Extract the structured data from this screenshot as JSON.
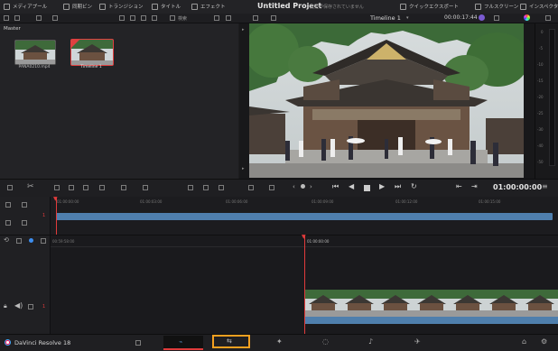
{
  "header": {
    "app_title": "Untitled Project",
    "status_text": "変更が保存されていません",
    "tabs_left": [
      {
        "label": "メディアプール",
        "icon": "media-pool-icon"
      },
      {
        "label": "同期ビン",
        "icon": "sync-bin-icon"
      },
      {
        "label": "トランジション",
        "icon": "transitions-icon"
      },
      {
        "label": "タイトル",
        "icon": "titles-icon"
      },
      {
        "label": "エフェクト",
        "icon": "effects-icon"
      }
    ],
    "tabs_right": [
      {
        "label": "クイックエクスポート",
        "icon": "quick-export-icon"
      },
      {
        "label": "フルスクリーン",
        "icon": "fullscreen-icon"
      },
      {
        "label": "インスペクタ",
        "icon": "inspector-icon"
      }
    ]
  },
  "media_pool": {
    "sort_label": "検索",
    "bin_name": "Master",
    "clips": [
      {
        "name": "PANA0210.mp4",
        "selected": false
      },
      {
        "name": "Timeline 1",
        "selected": true
      }
    ]
  },
  "viewer": {
    "timeline_name": "Timeline 1",
    "timecode_top": "00:00:17:44",
    "timecode_transport": "01:00:00:00"
  },
  "meter_labels": [
    "0",
    "-5",
    "-10",
    "-15",
    "-20",
    "-25",
    "-30",
    "-40",
    "-50"
  ],
  "upper_timeline": {
    "ruler": [
      "01:00:00:00",
      "01:00:03:00",
      "01:00:06:00",
      "01:00:09:00",
      "01:00:12:00",
      "01:00:15:00"
    ],
    "track_number": "1"
  },
  "lower_timeline": {
    "left_tc": "00:59:58:00",
    "playhead_tc": "01:00:00:00",
    "track_number": "1"
  },
  "footer": {
    "app_name": "DaVinci Resolve 18",
    "pages": [
      "media",
      "cut",
      "edit",
      "fusion",
      "color",
      "fairlight",
      "deliver"
    ]
  },
  "colors": {
    "accent_red": "#e03b3b",
    "clip_blue": "#4f7fad",
    "highlight_orange": "#f4a020"
  }
}
